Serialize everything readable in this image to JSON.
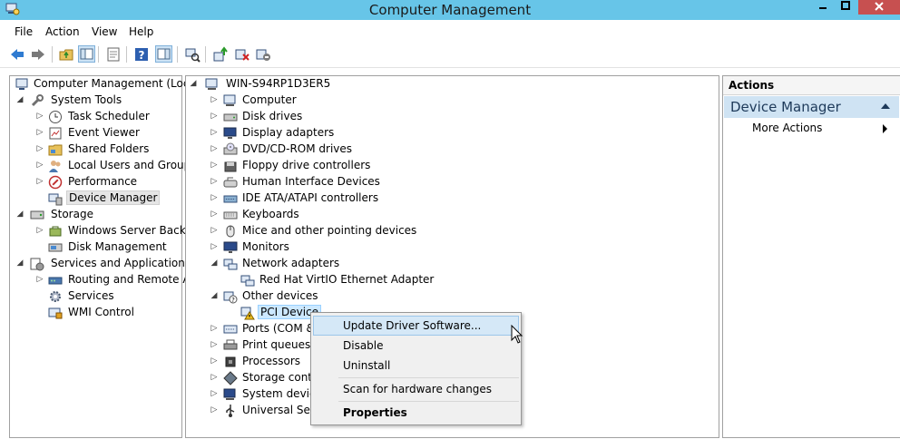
{
  "window": {
    "title": "Computer Management"
  },
  "menu": [
    "File",
    "Action",
    "View",
    "Help"
  ],
  "toolbar_icons": [
    "back-arrow-icon",
    "forward-arrow-icon",
    "up-folder-icon",
    "show-hide-tree-icon",
    "properties-icon",
    "help-icon",
    "show-hide-action-pane-icon",
    "scan-hardware-icon",
    "update-driver-icon",
    "uninstall-device-icon",
    "disable-device-icon"
  ],
  "left_tree": [
    {
      "label": "Computer Management (Local",
      "icon": "computer-management-icon"
    },
    {
      "label": "System Tools",
      "icon": "system-tools-icon"
    },
    {
      "label": "Task Scheduler",
      "icon": "clock-icon"
    },
    {
      "label": "Event Viewer",
      "icon": "event-viewer-icon"
    },
    {
      "label": "Shared Folders",
      "icon": "shared-folder-icon"
    },
    {
      "label": "Local Users and Groups",
      "icon": "users-icon"
    },
    {
      "label": "Performance",
      "icon": "performance-icon"
    },
    {
      "label": "Device Manager",
      "icon": "device-manager-icon"
    },
    {
      "label": "Storage",
      "icon": "storage-icon"
    },
    {
      "label": "Windows Server Backup",
      "icon": "backup-icon"
    },
    {
      "label": "Disk Management",
      "icon": "disk-management-icon"
    },
    {
      "label": "Services and Applications",
      "icon": "services-apps-icon"
    },
    {
      "label": "Routing and Remote Ac",
      "icon": "routing-icon"
    },
    {
      "label": "Services",
      "icon": "services-gear-icon"
    },
    {
      "label": "WMI Control",
      "icon": "wmi-icon"
    }
  ],
  "device_tree": [
    {
      "label": "WIN-S94RP1D3ER5",
      "icon": "computer-icon"
    },
    {
      "label": "Computer",
      "icon": "computer-icon"
    },
    {
      "label": "Disk drives",
      "icon": "disk-drive-icon"
    },
    {
      "label": "Display adapters",
      "icon": "display-adapter-icon"
    },
    {
      "label": "DVD/CD-ROM drives",
      "icon": "dvd-icon"
    },
    {
      "label": "Floppy drive controllers",
      "icon": "floppy-icon"
    },
    {
      "label": "Human Interface Devices",
      "icon": "hid-icon"
    },
    {
      "label": "IDE ATA/ATAPI controllers",
      "icon": "ide-icon"
    },
    {
      "label": "Keyboards",
      "icon": "keyboard-icon"
    },
    {
      "label": "Mice and other pointing devices",
      "icon": "mouse-icon"
    },
    {
      "label": "Monitors",
      "icon": "monitor-icon"
    },
    {
      "label": "Network adapters",
      "icon": "network-adapter-icon"
    },
    {
      "label": "Red Hat VirtIO Ethernet Adapter",
      "icon": "network-adapter-icon"
    },
    {
      "label": "Other devices",
      "icon": "unknown-device-icon"
    },
    {
      "label": "PCI Device",
      "icon": "warning-device-icon"
    },
    {
      "label": "Ports (COM &",
      "icon": "port-icon"
    },
    {
      "label": "Print queues",
      "icon": "printer-icon"
    },
    {
      "label": "Processors",
      "icon": "processor-icon"
    },
    {
      "label": "Storage contro",
      "icon": "storage-controller-icon"
    },
    {
      "label": "System device",
      "icon": "system-device-icon"
    },
    {
      "label": "Universal Seria",
      "icon": "usb-icon"
    }
  ],
  "actions": {
    "header": "Actions",
    "section": "Device Manager",
    "item": "More Actions"
  },
  "context_menu": {
    "update": "Update Driver Software...",
    "disable": "Disable",
    "uninstall": "Uninstall",
    "scan": "Scan for hardware changes",
    "properties": "Properties"
  }
}
